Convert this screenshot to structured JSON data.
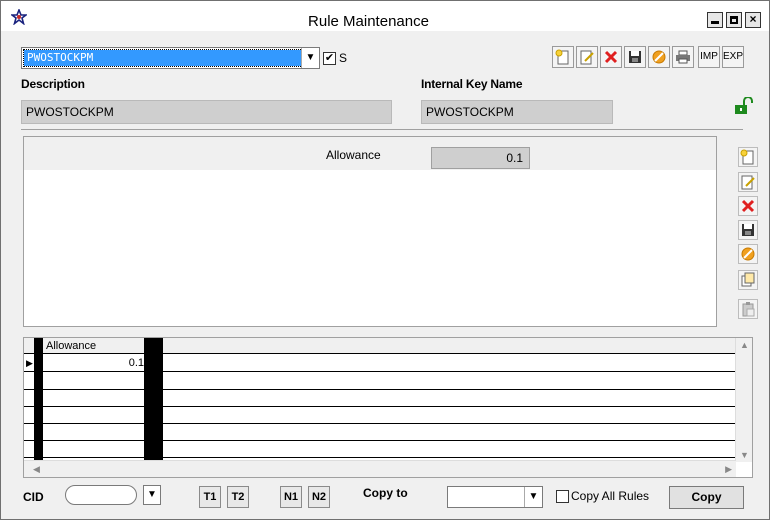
{
  "window": {
    "title": "Rule Maintenance"
  },
  "rule_selector": {
    "value": "PWOSTOCKPM",
    "checkbox_label": "S",
    "checked": true
  },
  "toolbar": {
    "imp_label": "IMP",
    "exp_label": "EXP"
  },
  "description": {
    "label": "Description",
    "value": "PWOSTOCKPM"
  },
  "internal_key": {
    "label": "Internal Key Name",
    "value": "PWOSTOCKPM"
  },
  "detail": {
    "allowance_label": "Allowance",
    "allowance_value": "0.1"
  },
  "grid": {
    "columns": [
      "Allowance"
    ],
    "rows": [
      [
        "0.1"
      ]
    ]
  },
  "bottom": {
    "cid_label": "CID",
    "t1_label": "T1",
    "t2_label": "T2",
    "n1_label": "N1",
    "n2_label": "N2",
    "copy_to_label": "Copy to",
    "copy_all_rules_label": "Copy All Rules",
    "copy_button_label": "Copy"
  },
  "colors": {
    "selection": "#3399ff",
    "readonly_field": "#cfcfcf",
    "delete_red": "#e02020",
    "cancel_orange": "#f0a020"
  }
}
